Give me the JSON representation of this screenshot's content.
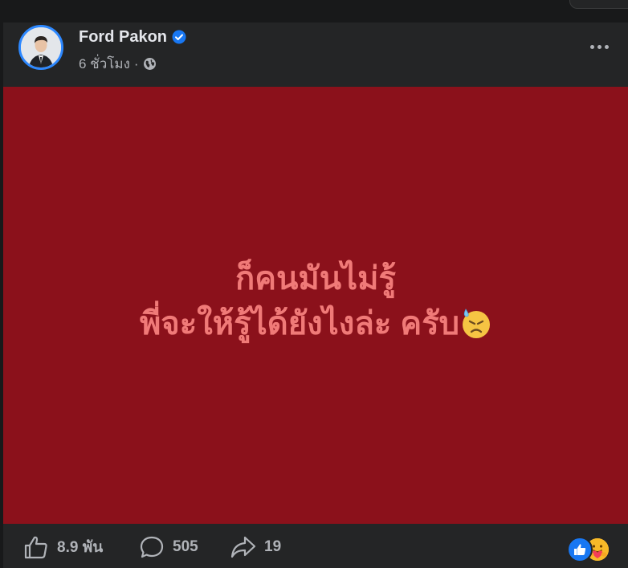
{
  "post": {
    "author": "Ford Pakon",
    "time": "6 ชั่วโมง",
    "separator": "·",
    "privacy_icon": "globe-icon",
    "verified_icon": "verified-badge-icon",
    "text_line1": "ก็คนมันไม่รู้",
    "text_line2": "พี่จะให้รู้ได้ยังไงล่ะ ครับ",
    "emoji": "downcast-face-with-sweat-emoji",
    "background_color": "#8b111b",
    "text_color": "#f07a78"
  },
  "stats": {
    "likes": "8.9 พัน",
    "comments": "505",
    "shares": "19"
  },
  "reactions": [
    "like",
    "care"
  ],
  "colors": {
    "accent": "#2d88ff",
    "card": "#242526",
    "page": "#18191a"
  }
}
